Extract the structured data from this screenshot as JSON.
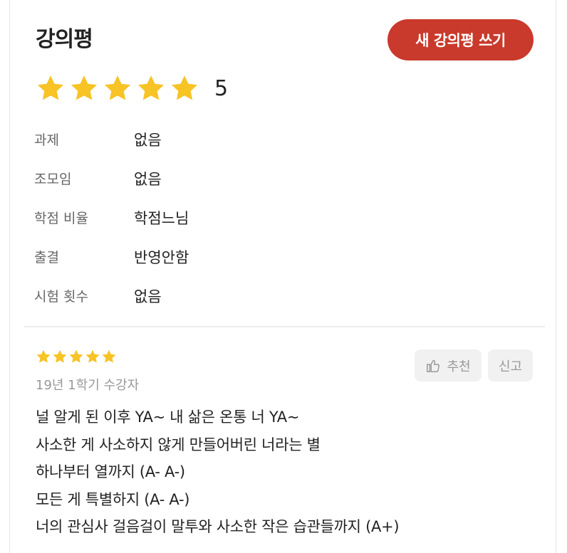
{
  "header": {
    "title": "강의평",
    "write_button": "새 강의평 쓰기"
  },
  "rating": {
    "stars": 5,
    "max_stars": 5,
    "value_text": "5",
    "star_color": "#f7c325"
  },
  "details": [
    {
      "label": "과제",
      "value": "없음"
    },
    {
      "label": "조모임",
      "value": "없음"
    },
    {
      "label": "학점 비율",
      "value": "학점느님"
    },
    {
      "label": "출결",
      "value": "반영안함"
    },
    {
      "label": "시험 횟수",
      "value": "없음"
    }
  ],
  "review": {
    "stars": 5,
    "semester": "19년 1학기 수강자",
    "recommend_label": "추천",
    "report_label": "신고",
    "lines": [
      "널 알게 된 이후 YA~ 내 삶은 온통 너 YA~",
      "사소한 게 사소하지 않게 만들어버린 너라는 별",
      "하나부터 열까지 (A- A-)",
      "모든 게 특별하지 (A- A-)",
      "너의 관심사 걸음걸이 말투와 사소한 작은 습관들까지 (A+)"
    ]
  },
  "colors": {
    "accent": "#c93a2c",
    "star": "#f7c325",
    "muted": "#999999"
  }
}
